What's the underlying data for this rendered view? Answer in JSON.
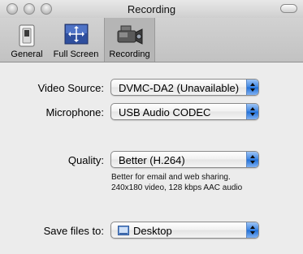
{
  "window": {
    "title": "Recording"
  },
  "toolbar": {
    "items": [
      {
        "label": "General",
        "icon": "switch-icon",
        "selected": false
      },
      {
        "label": "Full Screen",
        "icon": "fullscreen-icon",
        "selected": false
      },
      {
        "label": "Recording",
        "icon": "camcorder-icon",
        "selected": true
      }
    ]
  },
  "form": {
    "video_source": {
      "label": "Video Source:",
      "value": "DVMC-DA2 (Unavailable)"
    },
    "microphone": {
      "label": "Microphone:",
      "value": "USB Audio CODEC"
    },
    "quality": {
      "label": "Quality:",
      "value": "Better  (H.264)",
      "description_line1": "Better for email and web sharing.",
      "description_line2": "240x180 video, 128 kbps AAC audio"
    },
    "save_to": {
      "label": "Save files to:",
      "value": "Desktop",
      "icon": "desktop-folder-icon"
    }
  },
  "colors": {
    "accent": "#3d86e4",
    "window_bg": "#ececec"
  }
}
